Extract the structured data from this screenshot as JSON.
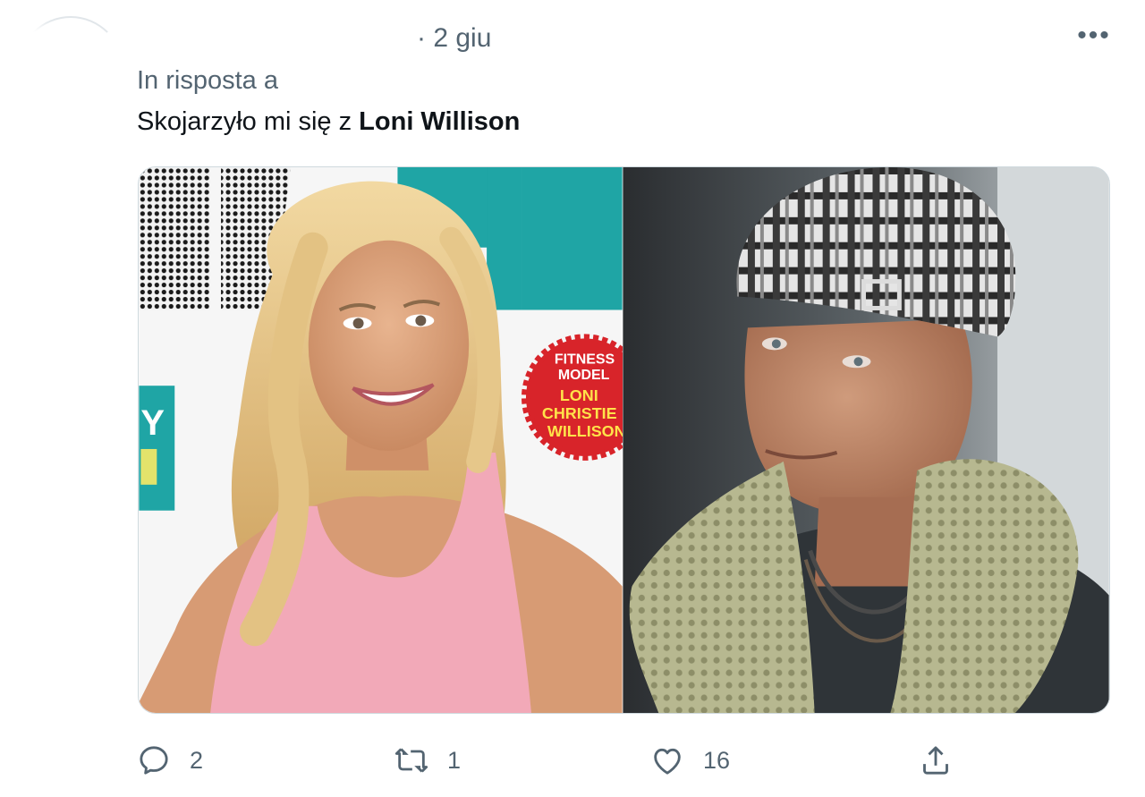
{
  "tweet": {
    "time": "· 2 giu",
    "more_label": "•••",
    "reply_prefix": "In risposta a",
    "text_prefix": "Skojarzyło mi się z ",
    "text_bold": "Loni Willison"
  },
  "media": {
    "left_image": {
      "alt": "Blonde woman in pink sports top on fitness magazine cover",
      "cover_badge": [
        "FITNESS",
        "MODEL",
        "LONI",
        "CHRISTIE",
        "WILLISON"
      ]
    },
    "right_image": {
      "alt": "Woman in plaid cap and green knitted scarf"
    }
  },
  "actions": {
    "reply_count": "2",
    "retweet_count": "1",
    "like_count": "16"
  },
  "icons": {
    "reply": "reply-icon",
    "retweet": "retweet-icon",
    "like": "heart-icon",
    "share": "share-icon"
  }
}
